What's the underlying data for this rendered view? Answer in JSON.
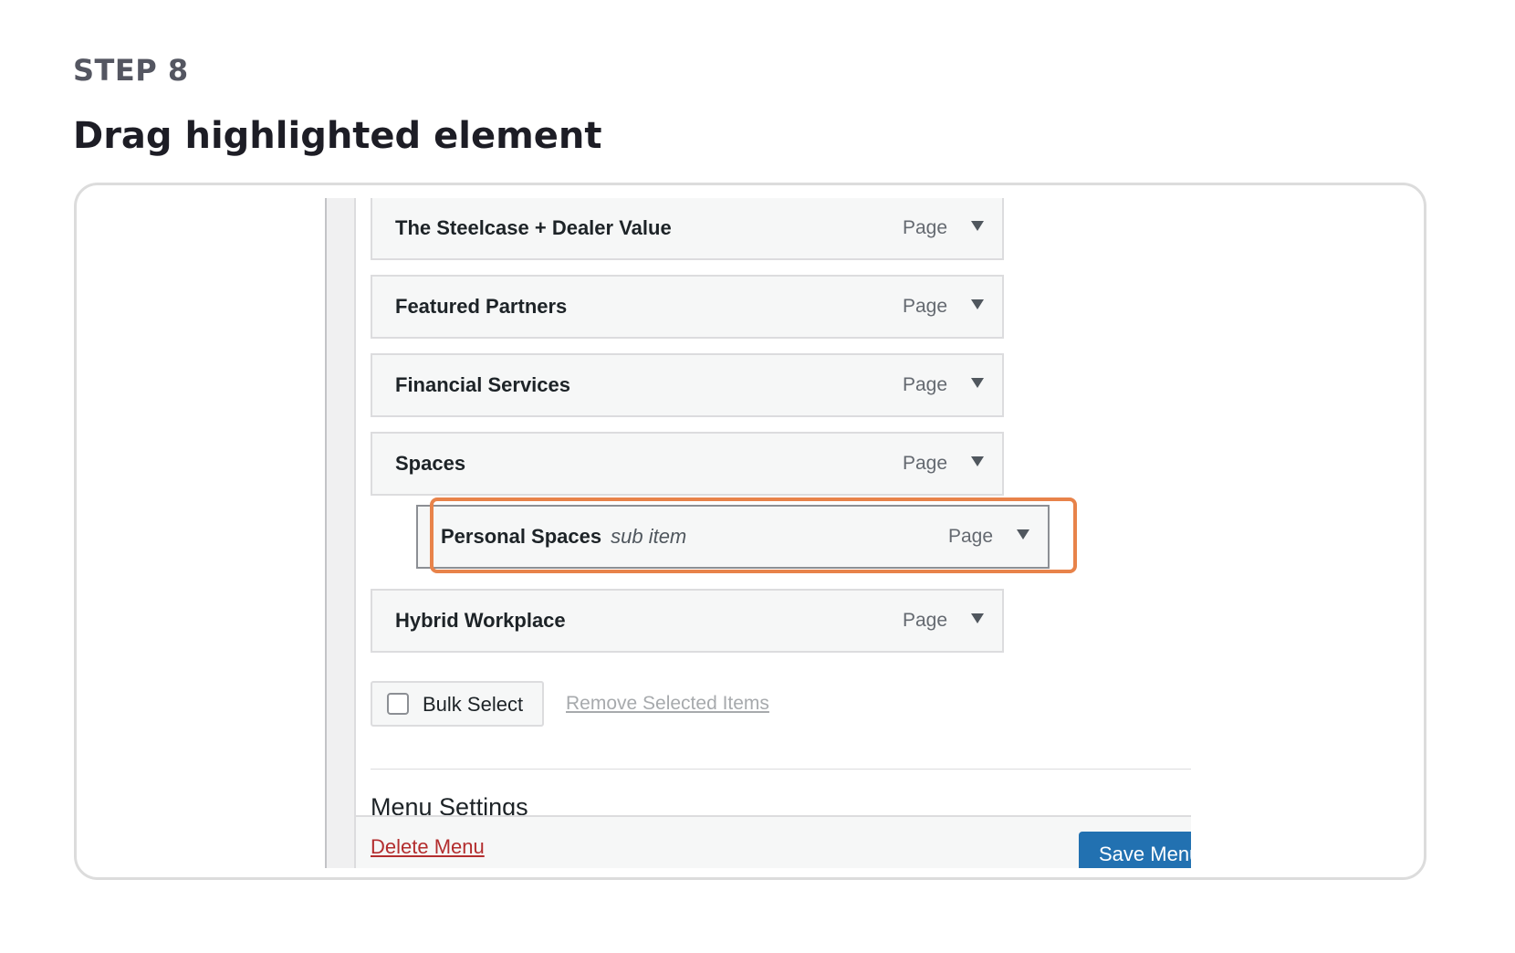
{
  "header": {
    "step_label": "STEP 8",
    "title": "Drag highlighted element"
  },
  "menu_items": [
    {
      "title": "The Steelcase + Dealer Value",
      "type": "Page"
    },
    {
      "title": "Featured Partners",
      "type": "Page"
    },
    {
      "title": "Financial Services",
      "type": "Page"
    },
    {
      "title": "Spaces",
      "type": "Page"
    },
    {
      "title": "Personal Spaces",
      "subtitle": "sub item",
      "type": "Page"
    },
    {
      "title": "Hybrid Workplace",
      "type": "Page"
    }
  ],
  "bulk_select": {
    "label": "Bulk Select",
    "remove_label": "Remove Selected Items"
  },
  "menu_settings": {
    "heading": "Menu Settings"
  },
  "footer": {
    "delete_label": "Delete Menu",
    "save_label": "Save Menu"
  },
  "colors": {
    "highlight": "#e8834a",
    "primary_button": "#2271b1",
    "delete_link": "#b32d2e"
  }
}
